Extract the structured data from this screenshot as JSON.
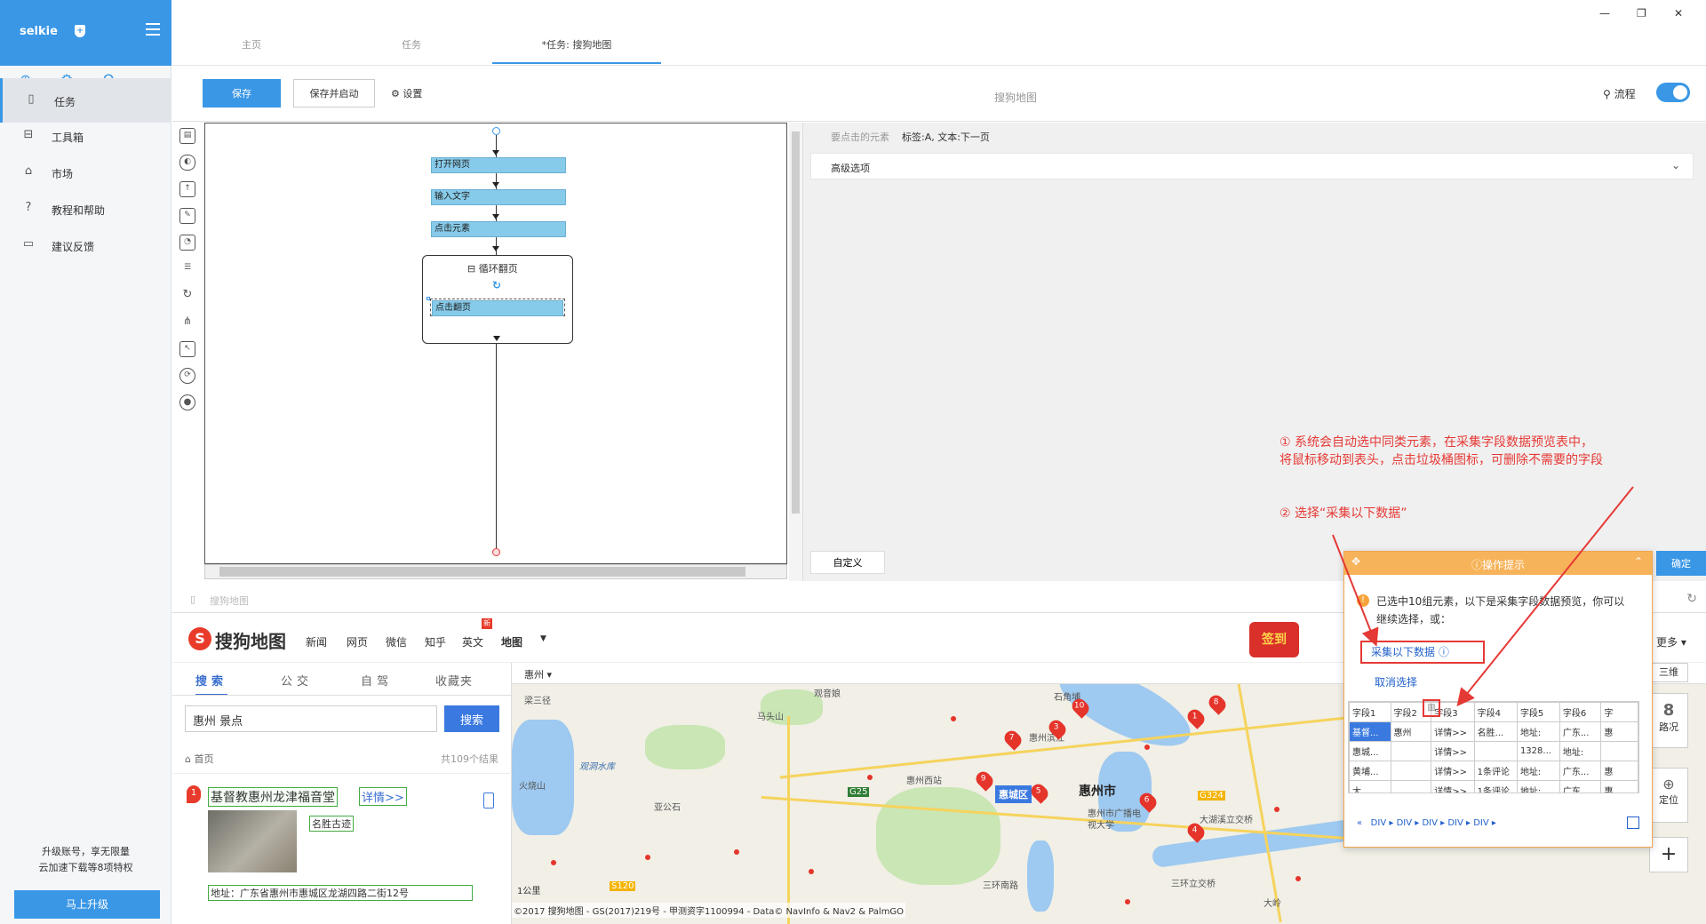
{
  "app": {
    "name": "selkie",
    "window_controls": [
      "—",
      "❐",
      "✕"
    ]
  },
  "sidebar": {
    "items": [
      {
        "label": "任务",
        "icon": "document-icon",
        "active": true
      },
      {
        "label": "工具箱",
        "icon": "toolbox-icon"
      },
      {
        "label": "市场",
        "icon": "lock-icon"
      },
      {
        "label": "教程和帮助",
        "icon": "help-icon"
      },
      {
        "label": "建议反馈",
        "icon": "chat-icon"
      }
    ],
    "upgrade_text_1": "升级账号，享无限量",
    "upgrade_text_2": "云加速下载等8项特权",
    "upgrade_button": "马上升级"
  },
  "tabs": [
    {
      "label": "主页"
    },
    {
      "label": "任务"
    },
    {
      "label": "*任务: 搜狗地图",
      "active": true
    }
  ],
  "toolbar": {
    "save_label": "保存",
    "save_run_label": "保存并启动",
    "settings_label": "设置",
    "title": "搜狗地图",
    "flow_label": "流程"
  },
  "workflow": {
    "nodes": [
      "打开网页",
      "输入文字",
      "点击元素"
    ],
    "loop_label": "循环翻页",
    "loop_child": "点击翻页"
  },
  "properties": {
    "element_label": "要点击的元素",
    "element_value": "标签:A, 文本:下一页",
    "advanced_label": "高级选项",
    "custom_label": "自定义",
    "ok_label": "确定"
  },
  "browser": {
    "address_text": "搜狗地图",
    "logo_text": "搜狗地图",
    "nav": [
      "新闻",
      "网页",
      "微信",
      "知乎",
      "英文",
      "地图"
    ],
    "nav_badge": "新",
    "qiandao": "签到",
    "more": "更多",
    "search_tabs": [
      "搜索",
      "公交",
      "自驾",
      "收藏夹"
    ],
    "search_value": "惠州 景点",
    "search_button": "搜索",
    "home_label": "首页",
    "result_count": "共109个结果",
    "result": {
      "index": "1",
      "title": "基督教惠州龙津福音堂",
      "detail": "详情>>",
      "tag": "名胜古迹",
      "address": "地址：广东省惠州市惠城区龙湖四路二街12号"
    },
    "map": {
      "city": "惠州",
      "labels": [
        "梁三径",
        "观音娘",
        "马头山",
        "观洞水库",
        "亚公石",
        "火烧山",
        "惠州西站",
        "惠州市",
        "惠城区",
        "惠州市广播电视大学",
        "大湖溪立交桥",
        "三环立交桥",
        "G25",
        "G324",
        "S120",
        "大岭",
        "石角埔",
        "三环南路",
        "惠州滨江"
      ],
      "district_badge": "惠城区",
      "city_label": "惠州市",
      "scale": "1公里",
      "copyright": "©2017 搜狗地图 - GS(2017)219号 - 甲测资字1100994 - Data© NavInfo & Nav2 & PalmGO",
      "pins": [
        "1",
        "3",
        "4",
        "5",
        "6",
        "7",
        "8",
        "9",
        "10"
      ],
      "controls": {
        "three_d": "三维",
        "traffic": "路况",
        "locate": "定位"
      }
    }
  },
  "hint": {
    "title": "操作提示",
    "message": "已选中10组元素，以下是采集字段数据预览，你可以继续选择，或：",
    "collect_label": "采集以下数据",
    "cancel_label": "取消选择",
    "headers": [
      "字段1",
      "字段2",
      "字段3",
      "字段4",
      "字段5",
      "字段6",
      "字"
    ],
    "rows": [
      [
        "基督...",
        "惠州",
        "详情>>",
        "名胜...",
        "地址:",
        "广东...",
        "惠"
      ],
      [
        "惠城...",
        "",
        "详情>>",
        "",
        "1328...",
        "地址:",
        ""
      ],
      [
        "黄埔...",
        "",
        "详情>>",
        "1条评论",
        "地址:",
        "广东...",
        "惠"
      ],
      [
        "大...",
        "",
        "详情>>",
        "1条评论",
        "地址:",
        "广东...",
        "惠"
      ]
    ],
    "crumbs": [
      "DIV",
      "DIV",
      "DIV",
      "DIV",
      "DIV"
    ]
  },
  "annotations": {
    "note1_line1": "① 系统会自动选中同类元素，在采集字段数据预览表中，",
    "note1_line2": "将鼠标移动到表头，点击垃圾桶图标，可删除不需要的字段",
    "note2": "② 选择“采集以下数据”"
  },
  "colors": {
    "accent": "#3a97e6",
    "annotation": "#e53935",
    "hint_header": "#f7b359",
    "node": "#87cbea"
  }
}
